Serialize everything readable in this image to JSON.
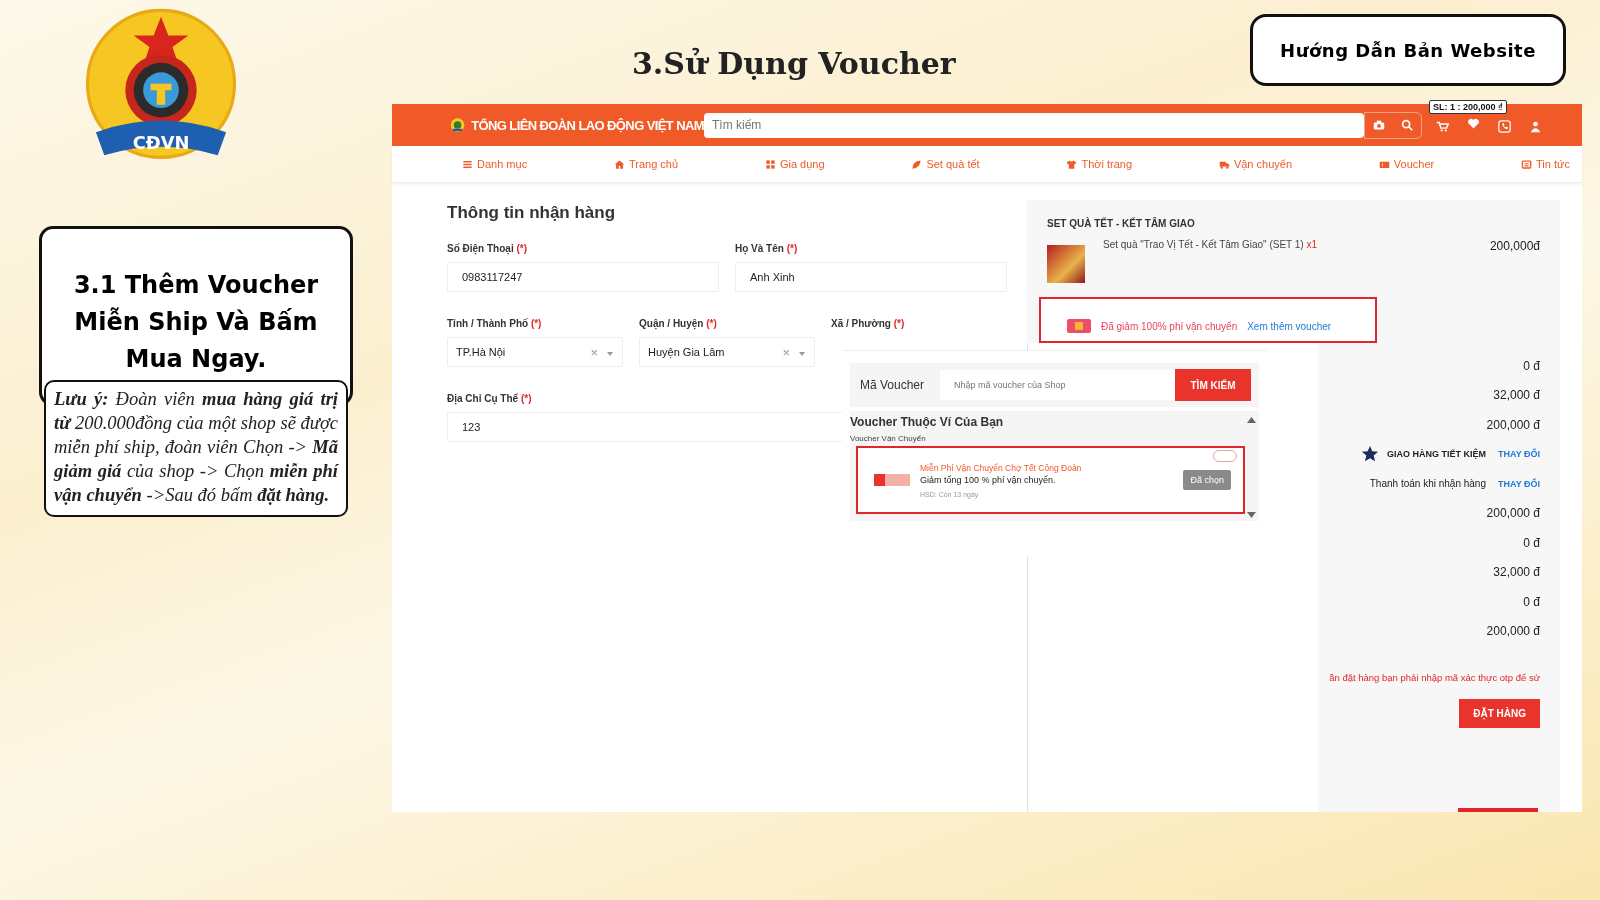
{
  "slide": {
    "logo_text": "CĐVN",
    "title": "3.Sử Dụng Voucher",
    "guide_button": "Hướng Dẫn Bản Website",
    "step_heading": "3.1 Thêm Voucher Miễn Ship Và Bấm Mua Ngay.",
    "note": "**Lưu ý:** Đoàn viên **mua hàng giá trị từ** 200.000đồng của một shop sẽ được miễn phí ship, đoàn viên Chọn -> **Mã giảm giá** của shop -> Chọn **miễn phí vận chuyển** ->Sau đó bấm **đặt hàng.**"
  },
  "site": {
    "brand": "TỔNG LIÊN ĐOÀN LAO ĐỘNG VIỆT NAM",
    "search_placeholder": "Tìm kiếm",
    "cart_tooltip": "SL: 1 : 200,000 ₫",
    "nav": [
      {
        "label": "Danh mục"
      },
      {
        "label": "Trang chủ"
      },
      {
        "label": "Gia dụng"
      },
      {
        "label": "Set quà tết"
      },
      {
        "label": "Thời trang"
      },
      {
        "label": "Vận chuyển"
      },
      {
        "label": "Voucher"
      },
      {
        "label": "Tin tức"
      }
    ]
  },
  "form": {
    "title": "Thông tin nhận hàng",
    "rows": [
      [
        {
          "kind": "text",
          "label": "Số Điện Thoại",
          "mark": "(*)",
          "value": "0983117247"
        },
        {
          "kind": "text",
          "label": "Họ Và Tên",
          "mark": "(*)",
          "value": "Anh Xinh"
        }
      ],
      [
        {
          "kind": "select",
          "label": "Tỉnh / Thành Phố",
          "mark": "(*)",
          "value": "TP.Hà Nội",
          "clear": "×"
        },
        {
          "kind": "select",
          "label": "Quận / Huyện",
          "mark": "(*)",
          "value": "Huyện Gia Lâm",
          "clear": "×"
        },
        {
          "kind": "label",
          "label": "Xã / Phường",
          "mark": "(*)"
        }
      ],
      [
        {
          "kind": "text",
          "label": "Địa Chỉ Cụ Thể",
          "mark": "(*)",
          "value": "123"
        }
      ]
    ]
  },
  "voucher_popup": {
    "code_label": "Mã Voucher",
    "code_placeholder": "Nhập mã voucher của Shop",
    "search_button": "TÌM KIẾM",
    "wallet_title": "Voucher Thuộc Ví Của Bạn",
    "group_title": "Voucher Vận Chuyển",
    "vouchers": [
      {
        "title": "Miễn Phí Vận Chuyển Chợ Tết Công Đoàn",
        "description": "Giảm tổng 100 % phí vận chuyển.",
        "expiry": "HSD: Còn 13 ngày",
        "action": "Đã chọn",
        "selected": true,
        "highlighted": true
      }
    ]
  },
  "order": {
    "shop": "SET QUÀ TẾT - KẾT TÂM GIAO",
    "product": {
      "name": "Set quà \"Trao Vị Tết - Kết Tâm Giao\" (SET 1)",
      "qty": "x1",
      "price": "200,000đ"
    },
    "applied_voucher": {
      "text": "Đã giảm 100% phí vận chuyển",
      "link": "Xem thêm voucher",
      "highlighted": true
    },
    "summary": [
      {
        "kind": "amount",
        "value": "0 đ"
      },
      {
        "kind": "amount",
        "value": "32,000 đ"
      },
      {
        "kind": "amount",
        "value": "200,000 đ"
      },
      {
        "kind": "shipping",
        "label": "GIAO HÀNG TIẾT KIỆM",
        "action": "THAY ĐỔI"
      },
      {
        "kind": "payment",
        "label": "Thanh toán khi nhận hàng",
        "action": "THAY ĐỔI"
      },
      {
        "kind": "amount",
        "value": "200,000 đ"
      },
      {
        "kind": "amount",
        "value": "0 đ"
      },
      {
        "kind": "amount",
        "value": "32,000 đ"
      },
      {
        "kind": "amount",
        "value": "0 đ"
      },
      {
        "kind": "amount",
        "value": "200,000 đ"
      }
    ],
    "otp_note": "ần đặt hàng bạn phải nhập mã xác thực otp để sử",
    "order_button": "ĐẶT HÀNG"
  }
}
